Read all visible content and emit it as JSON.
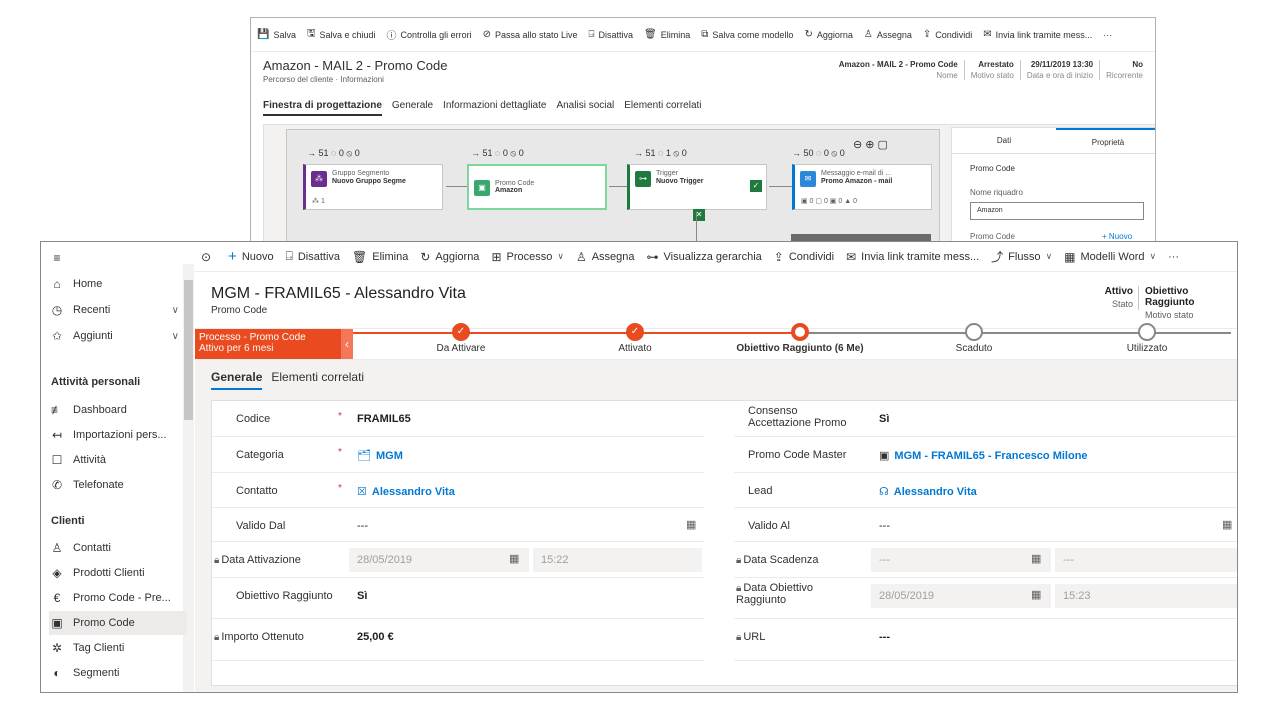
{
  "back": {
    "toolbar": [
      "Salva",
      "Salva e chiudi",
      "Controlla gli errori",
      "Passa allo stato Live",
      "Disattiva",
      "Elimina",
      "Salva come modello",
      "Aggiorna",
      "Assegna",
      "Condividi",
      "Invia link tramite mess...",
      "···"
    ],
    "title": "Amazon - MAIL 2 - Promo Code",
    "subtitle": "Percorso del cliente · Informazioni",
    "header_fields": [
      {
        "value": "Amazon - MAIL 2 - Promo Code",
        "label": "Nome"
      },
      {
        "value": "Arrestato",
        "label": "Motivo stato"
      },
      {
        "value": "29/11/2019 13:30",
        "label": "Data e ora di inizio"
      },
      {
        "value": "No",
        "label": "Ricorrente"
      }
    ],
    "tabs": [
      "Finestra di progettazione",
      "Generale",
      "Informazioni dettagliate",
      "Analisi social",
      "Elementi correlati"
    ],
    "stats": [
      "→ 51  ◌ 0  ⦸ 0",
      "→ 51  ◌ 0  ⦸ 0",
      "→ 51  ◌ 1  ⦸ 0",
      "→ 50  ◌ 0  ⦸ 0"
    ],
    "tiles": [
      {
        "l1": "Gruppo Segmento",
        "l2": "Nuovo Gruppo Segme",
        "l3": "⁂ 1"
      },
      {
        "l1": "Promo Code",
        "l2": "Amazon",
        "l3": ""
      },
      {
        "l1": "Trigger",
        "l2": "Nuovo Trigger",
        "l3": ""
      },
      {
        "l1": "Messaggio e-mail di ...",
        "l2": "Promo Amazon - mail",
        "l3": "▣ 0  ▢ 0  ▣ 0  ▲ 0"
      }
    ],
    "props": {
      "tab_data": "Dati",
      "tab_props": "Proprietà",
      "section": "Promo Code",
      "name_label": "Nome riquadro",
      "name_value": "Amazon",
      "promo_label": "Promo Code",
      "new_link": "+ Nuovo"
    }
  },
  "sidebar": {
    "top": [
      {
        "icon": "≡",
        "label": "",
        "name": "hamburger"
      },
      {
        "icon": "⌂",
        "label": "Home",
        "name": "home"
      },
      {
        "icon": "◷",
        "label": "Recenti",
        "name": "recenti",
        "chev": "∨"
      },
      {
        "icon": "✩",
        "label": "Aggiunti",
        "name": "aggiunti",
        "chev": "∨"
      }
    ],
    "section1": "Attività personali",
    "items1": [
      {
        "icon": "≢",
        "label": "Dashboard"
      },
      {
        "icon": "↤",
        "label": "Importazioni pers..."
      },
      {
        "icon": "☐",
        "label": "Attività"
      },
      {
        "icon": "✆",
        "label": "Telefonate"
      }
    ],
    "section2": "Clienti",
    "items2": [
      {
        "icon": "♙",
        "label": "Contatti"
      },
      {
        "icon": "◈",
        "label": "Prodotti Clienti"
      },
      {
        "icon": "€",
        "label": "Promo Code - Pre..."
      },
      {
        "icon": "▣",
        "label": "Promo Code"
      },
      {
        "icon": "✲",
        "label": "Tag Clienti"
      },
      {
        "icon": "◐",
        "label": "Segmenti"
      }
    ]
  },
  "cmdbar": [
    {
      "icon": "⊙",
      "label": ""
    },
    {
      "icon": "+",
      "label": "Nuovo"
    },
    {
      "icon": "⍈",
      "label": "Disattiva"
    },
    {
      "icon": "🗑",
      "label": "Elimina"
    },
    {
      "icon": "↻",
      "label": "Aggiorna"
    },
    {
      "icon": "⊞",
      "label": "Processo",
      "chev": "∨"
    },
    {
      "icon": "♙",
      "label": "Assegna"
    },
    {
      "icon": "⊶",
      "label": "Visualizza gerarchia"
    },
    {
      "icon": "⇪",
      "label": "Condividi"
    },
    {
      "icon": "✉",
      "label": "Invia link tramite mess..."
    },
    {
      "icon": "⤴",
      "label": "Flusso",
      "chev": "∨"
    },
    {
      "icon": "▦",
      "label": "Modelli Word",
      "chev": "∨"
    },
    {
      "icon": "",
      "label": "···"
    }
  ],
  "record": {
    "title": "MGM - FRAMIL65 - Alessandro Vita",
    "entity": "Promo Code",
    "status_value": "Attivo",
    "status_label": "Stato",
    "reason_value": "Obiettivo Raggiunto",
    "reason_label": "Motivo stato"
  },
  "bpf": {
    "name": "Processo - Promo Code",
    "sub": "Attivo per 6 mesi",
    "stages": [
      {
        "label": "Da Attivare",
        "state": "done"
      },
      {
        "label": "Attivato",
        "state": "done"
      },
      {
        "label": "Obiettivo Raggiunto  (6 Me)",
        "state": "active"
      },
      {
        "label": "Scaduto",
        "state": "todo"
      },
      {
        "label": "Utilizzato",
        "state": "todo"
      }
    ],
    "colors": {
      "done": "#ea4a1f",
      "todo": "#8a8886"
    }
  },
  "tabs": [
    "Generale",
    "Elementi correlati"
  ],
  "form": {
    "left": [
      {
        "label": "Codice",
        "req": "*",
        "value": "FRAMIL65",
        "style": "bold"
      },
      {
        "label": "Categoria",
        "req": "*",
        "value": "MGM",
        "style": "link",
        "icon": "🗂"
      },
      {
        "label": "Contatto",
        "req": "*",
        "value": "Alessandro Vita",
        "style": "link",
        "icon": "☒"
      },
      {
        "label": "Valido Dal",
        "value": "---",
        "cal": true
      },
      {
        "label": "Data Attivazione",
        "lock": true,
        "date": "28/05/2019",
        "time": "15:22"
      },
      {
        "label": "Obiettivo Raggiunto",
        "value": "Sì",
        "style": "bold"
      },
      {
        "label": "Importo Ottenuto",
        "lock": true,
        "value": "25,00 €",
        "style": "bold"
      }
    ],
    "right": [
      {
        "label": "Consenso",
        "label2": "Accettazione Promo",
        "value": "Sì",
        "style": "bold"
      },
      {
        "label": "Promo Code Master",
        "value": "MGM - FRAMIL65 - Francesco Milone",
        "style": "link",
        "icon": "▣"
      },
      {
        "label": "Lead",
        "value": "Alessandro Vita",
        "style": "link",
        "icon": "☊"
      },
      {
        "label": "Valido Al",
        "value": "---",
        "cal": true
      },
      {
        "label": "Data Scadenza",
        "lock": true,
        "date": "---",
        "time": "---"
      },
      {
        "label": "Data Obiettivo",
        "label2": "Raggiunto",
        "lock": true,
        "date": "28/05/2019",
        "time": "15:23"
      },
      {
        "label": "URL",
        "lock": true,
        "value": "---",
        "style": "bold"
      }
    ]
  }
}
